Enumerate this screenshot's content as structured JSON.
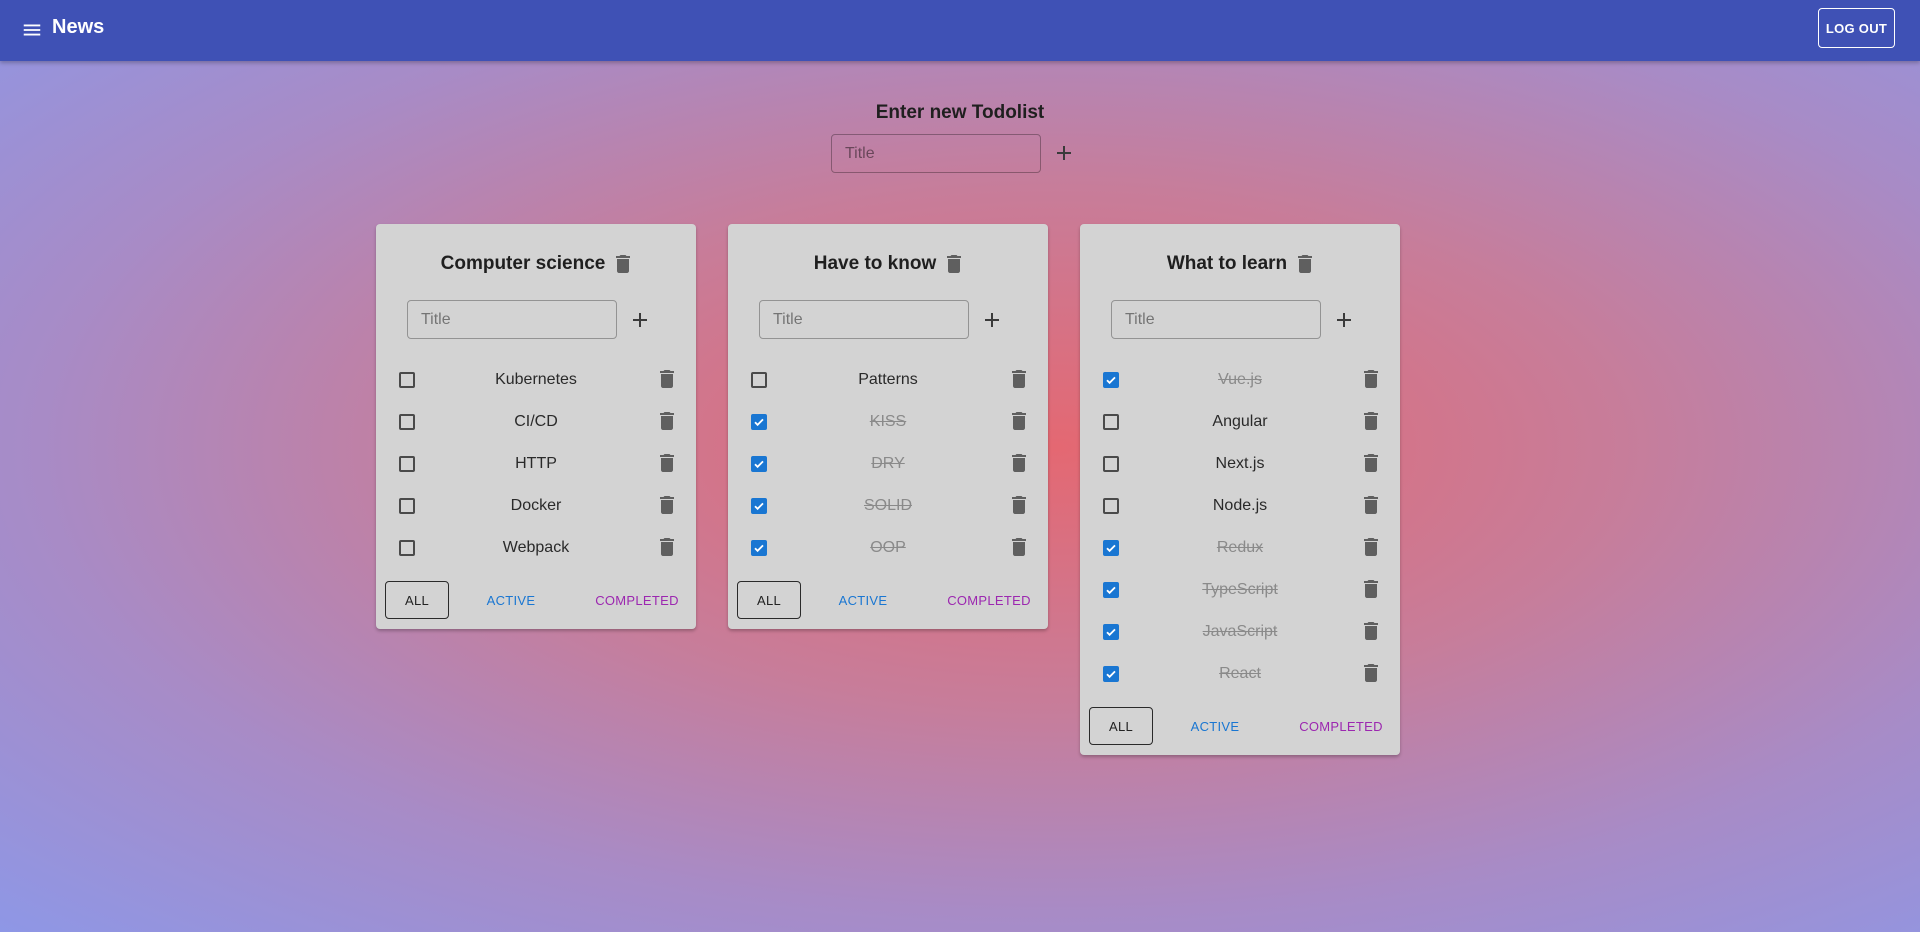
{
  "appbar": {
    "title": "News",
    "logout_label": "LOG OUT",
    "menu_icon": "menu-icon"
  },
  "new_todolist": {
    "heading": "Enter new Todolist",
    "placeholder": "Title"
  },
  "filters": {
    "all": "ALL",
    "active": "ACTIVE",
    "completed": "COMPLETED"
  },
  "colors": {
    "appbar": "#3f51b5",
    "checkbox": "#1976d2",
    "active": "#1976d2",
    "completed": "#9c27b0",
    "card": "#d3d3d3"
  },
  "todolists": [
    {
      "title": "Computer science",
      "placeholder": "Title",
      "tasks": [
        {
          "label": "Kubernetes",
          "done": false
        },
        {
          "label": "CI/CD",
          "done": false
        },
        {
          "label": "HTTP",
          "done": false
        },
        {
          "label": "Docker",
          "done": false
        },
        {
          "label": "Webpack",
          "done": false
        }
      ]
    },
    {
      "title": "Have to know",
      "placeholder": "Title",
      "tasks": [
        {
          "label": "Patterns",
          "done": false
        },
        {
          "label": "KISS",
          "done": true
        },
        {
          "label": "DRY",
          "done": true
        },
        {
          "label": "SOLID",
          "done": true
        },
        {
          "label": "OOP",
          "done": true
        }
      ]
    },
    {
      "title": "What to learn",
      "placeholder": "Title",
      "tasks": [
        {
          "label": "Vue.js",
          "done": true
        },
        {
          "label": "Angular",
          "done": false
        },
        {
          "label": "Next.js",
          "done": false
        },
        {
          "label": "Node.js",
          "done": false
        },
        {
          "label": "Redux",
          "done": true
        },
        {
          "label": "TypeScript",
          "done": true
        },
        {
          "label": "JavaScript",
          "done": true
        },
        {
          "label": "React",
          "done": true
        }
      ]
    }
  ]
}
